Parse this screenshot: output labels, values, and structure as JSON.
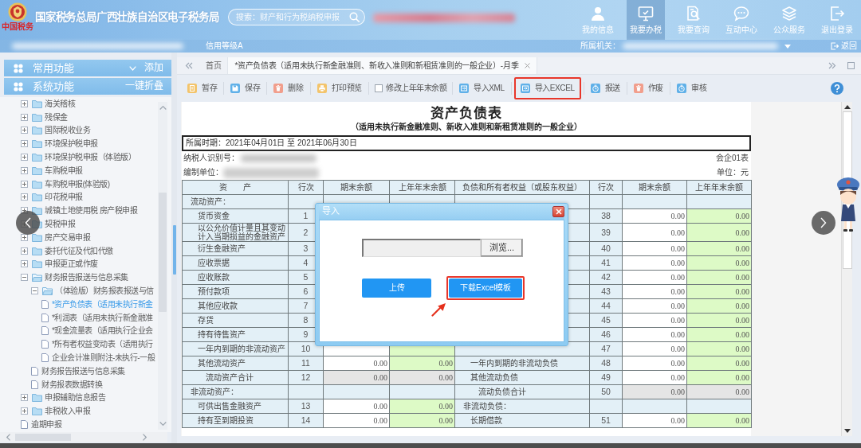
{
  "header": {
    "logo_caption": "中国税务",
    "title": "国家税务总局广西壮族自治区电子税务局",
    "search": {
      "placeholder": "搜索：财产和行为税纳税申报"
    },
    "nav": [
      {
        "kind": "profile",
        "label": "我的信息",
        "selected": false
      },
      {
        "kind": "handle",
        "label": "我要办税",
        "selected": true
      },
      {
        "kind": "query",
        "label": "我要查询",
        "selected": false
      },
      {
        "kind": "interact",
        "label": "互动中心",
        "selected": false
      },
      {
        "kind": "public",
        "label": "公众服务",
        "selected": false
      },
      {
        "kind": "logout",
        "label": "退出登录",
        "selected": false
      }
    ]
  },
  "info_bar": {
    "credit": "信用等级A",
    "authority_label": "所属机关：",
    "back": "返回"
  },
  "sidebar": {
    "panels": [
      {
        "kind": "collapsible",
        "label": "常用功能",
        "action": "添加"
      },
      {
        "kind": "plain",
        "label": "系统功能",
        "action": "一键折叠"
      }
    ],
    "tree": [
      {
        "kind": "folder",
        "label": "海关稽核",
        "expanded": false,
        "selected": false
      },
      {
        "kind": "folder",
        "label": "残保金",
        "expanded": false,
        "selected": false
      },
      {
        "kind": "folder",
        "label": "国际税收业务",
        "expanded": false,
        "selected": false
      },
      {
        "kind": "folder",
        "label": "环境保护税申报",
        "expanded": false,
        "selected": false
      },
      {
        "kind": "folder",
        "label": "环境保护税申报（体验版）",
        "expanded": false,
        "selected": false
      },
      {
        "kind": "folder",
        "label": "车购税申报",
        "expanded": false,
        "selected": false
      },
      {
        "kind": "folder",
        "label": "车购税申报(体验版)",
        "expanded": false,
        "selected": false
      },
      {
        "kind": "folder",
        "label": "印花税申报",
        "expanded": false,
        "selected": false
      },
      {
        "kind": "folder",
        "label": "城镇土地使用税 房产税申报",
        "expanded": false,
        "selected": false
      },
      {
        "kind": "folder",
        "label": "契税申报",
        "expanded": false,
        "selected": false
      },
      {
        "kind": "folder",
        "label": "房产交易申报",
        "expanded": false,
        "selected": false
      },
      {
        "kind": "folder",
        "label": "委托代征及代扣代缴",
        "expanded": false,
        "selected": false
      },
      {
        "kind": "folder",
        "label": "申报更正或作废",
        "expanded": false,
        "selected": false
      },
      {
        "kind": "folder",
        "label": "财务报告报送与信息采集",
        "expanded": true,
        "selected": false,
        "children": [
          {
            "kind": "folder",
            "label": "（体验版）财务报表报送与信",
            "expanded": true,
            "selected": false,
            "children": [
              {
                "kind": "file",
                "label": "*资产负债表（适用未执行新金",
                "selected": true
              },
              {
                "kind": "file",
                "label": "*利润表（适用未执行新金融准",
                "selected": false
              },
              {
                "kind": "file",
                "label": "*现金流量表（适用执行企业会",
                "selected": false
              },
              {
                "kind": "file",
                "label": "*所有者权益变动表（适用执行",
                "selected": false
              },
              {
                "kind": "file",
                "label": "企业会计准则附注-未执行-一般",
                "selected": false
              }
            ]
          },
          {
            "kind": "file",
            "label": "财务报告报送与信息采集",
            "selected": false
          },
          {
            "kind": "file",
            "label": "财务报表数据转换",
            "selected": false
          }
        ]
      },
      {
        "kind": "folder",
        "label": "申报辅助信息报告",
        "expanded": false,
        "selected": false
      },
      {
        "kind": "folder",
        "label": "非税收入申报",
        "expanded": false,
        "selected": false
      },
      {
        "kind": "file",
        "label": "逾期申报",
        "selected": false
      }
    ]
  },
  "tabs": [
    {
      "label": "首页",
      "selected": false,
      "closable": false
    },
    {
      "label": "*资产负债表（适用未执行新金融准则、新收入准则和新租赁准则的一般企业）-月季",
      "selected": true,
      "closable": true
    }
  ],
  "toolbar": [
    {
      "kind": "draft",
      "label": "暂存",
      "highlighted": false
    },
    {
      "kind": "save",
      "label": "保存",
      "highlighted": false
    },
    {
      "kind": "delete",
      "label": "删除",
      "highlighted": false
    },
    {
      "kind": "print",
      "label": "打印预览",
      "highlighted": false
    },
    {
      "kind": "checkbox",
      "label": "修改上年年末余额",
      "checked": false,
      "highlighted": false
    },
    {
      "kind": "import",
      "label": "导入XML",
      "highlighted": false
    },
    {
      "kind": "import",
      "label": "导入EXCEL",
      "highlighted": true
    },
    {
      "kind": "submit",
      "label": "报送",
      "highlighted": false
    },
    {
      "kind": "void",
      "label": "作废",
      "highlighted": false
    },
    {
      "kind": "review",
      "label": "审核",
      "highlighted": false
    }
  ],
  "document": {
    "title": "资产负债表",
    "subtitle": "（适用未执行新金融准则、新收入准则和新租赁准则的一般企业）",
    "period": "所属时期：2021年04月01日 至 2021年06月30日",
    "taxpayer_label": "纳税人识别号：",
    "form_code": "会企01表",
    "preparer_label": "编制单位：",
    "unit": "单位：元",
    "columns": [
      "资　　产",
      "行次",
      "期末余额",
      "上年年末余额",
      "负债和所有者权益（或股东权益）",
      "行次",
      "期末余额",
      "上年年末余额"
    ],
    "rows": [
      {
        "left": {
          "kind": "section",
          "label": "流动资产："
        },
        "right": {
          "kind": "section"
        }
      },
      {
        "left": {
          "kind": "item",
          "label": "货币资金",
          "line": "1"
        },
        "right": {
          "kind": "item",
          "line": "38",
          "end": "0.00",
          "prior": "0.00"
        }
      },
      {
        "left": {
          "kind": "item",
          "label": "以公允价值计量且其变动计入当期损益的金融资产",
          "line": "2"
        },
        "right": {
          "kind": "item",
          "line": "39",
          "end": "0.00",
          "prior": "0.00"
        }
      },
      {
        "left": {
          "kind": "item",
          "label": "衍生金融资产",
          "line": "3"
        },
        "right": {
          "kind": "item",
          "line": "40",
          "end": "0.00",
          "prior": "0.00"
        }
      },
      {
        "left": {
          "kind": "item",
          "label": "应收票据",
          "line": "4"
        },
        "right": {
          "kind": "item",
          "line": "41",
          "end": "0.00",
          "prior": "0.00"
        }
      },
      {
        "left": {
          "kind": "item",
          "label": "应收账款",
          "line": "5"
        },
        "right": {
          "kind": "item",
          "line": "42",
          "end": "0.00",
          "prior": "0.00"
        }
      },
      {
        "left": {
          "kind": "item",
          "label": "预付款项",
          "line": "6"
        },
        "right": {
          "kind": "item",
          "line": "43",
          "end": "0.00",
          "prior": "0.00"
        }
      },
      {
        "left": {
          "kind": "item",
          "label": "其他应收款",
          "line": "7"
        },
        "right": {
          "kind": "item",
          "line": "44",
          "end": "0.00",
          "prior": "0.00"
        }
      },
      {
        "left": {
          "kind": "item",
          "label": "存货",
          "line": "8"
        },
        "right": {
          "kind": "item",
          "line": "45",
          "end": "0.00",
          "prior": "0.00"
        }
      },
      {
        "left": {
          "kind": "item",
          "label": "持有待售资产",
          "line": "9"
        },
        "right": {
          "kind": "item",
          "line": "46",
          "end": "0.00",
          "prior": "0.00"
        }
      },
      {
        "left": {
          "kind": "item",
          "label": "一年内到期的非流动资产",
          "line": "10"
        },
        "right": {
          "kind": "item",
          "line": "47",
          "end": "0.00",
          "prior": "0.00"
        }
      },
      {
        "left": {
          "kind": "item",
          "label": "其他流动资产",
          "line": "11",
          "end": "0.00",
          "prior": "0.00"
        },
        "right": {
          "kind": "item",
          "label": "一年内到期的非流动负债",
          "line": "48",
          "end": "0.00",
          "prior": "0.00"
        }
      },
      {
        "left": {
          "kind": "total",
          "label": "流动资产合计",
          "line": "12",
          "end": "0.00",
          "prior": "0.00"
        },
        "right": {
          "kind": "item",
          "label": "其他流动负债",
          "line": "49",
          "end": "0.00",
          "prior": "0.00"
        }
      },
      {
        "left": {
          "kind": "section",
          "label": "非流动资产："
        },
        "right": {
          "kind": "total",
          "label": "流动负债合计",
          "line": "50",
          "end": "0.00",
          "prior": "0.00"
        }
      },
      {
        "left": {
          "kind": "item",
          "label": "可供出售金融资产",
          "line": "13",
          "end": "0.00",
          "prior": "0.00"
        },
        "right": {
          "kind": "section",
          "label": "非流动负债："
        }
      },
      {
        "left": {
          "kind": "item",
          "label": "持有至到期投资",
          "line": "14",
          "end": "0.00",
          "prior": "0.00"
        },
        "right": {
          "kind": "item",
          "label": "长期借款",
          "line": "51",
          "end": "0.00",
          "prior": "0.00"
        }
      }
    ]
  },
  "dialog": {
    "title": "导入",
    "browse": "浏览...",
    "buttons": [
      {
        "label": "上传",
        "highlighted": false
      },
      {
        "label": "下载Excel模板",
        "highlighted": true
      }
    ]
  }
}
